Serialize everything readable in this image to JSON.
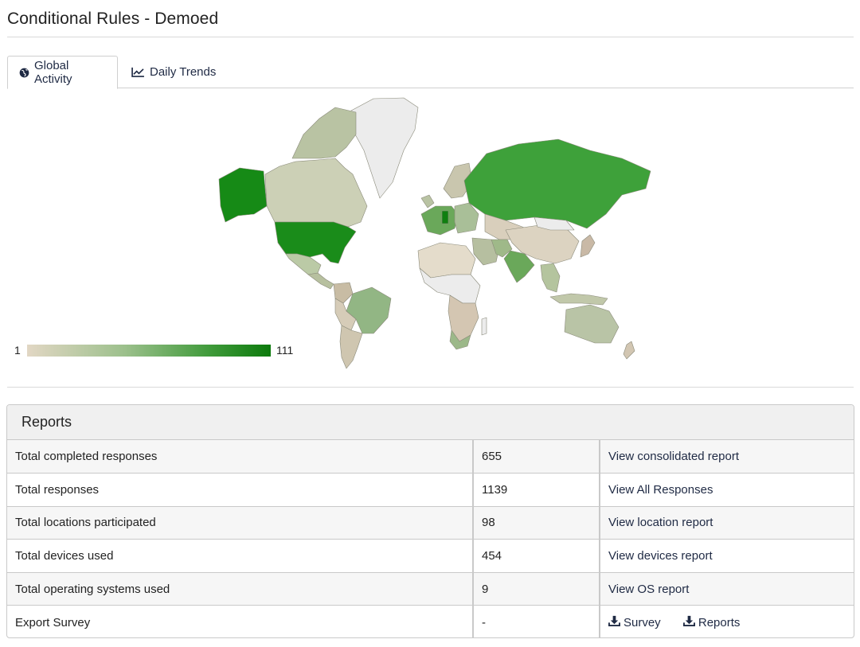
{
  "header": {
    "title": "Conditional Rules - Demoed"
  },
  "tabs": [
    {
      "label": "Global Activity",
      "icon": "globe-icon",
      "active": true
    },
    {
      "label": "Daily Trends",
      "icon": "line-chart-icon",
      "active": false
    }
  ],
  "legend": {
    "min": "1",
    "max": "111"
  },
  "colors": {
    "low": "#e2d7c4",
    "mid": "#9cc08c",
    "high": "#0c7a0c",
    "none": "#ececec"
  },
  "reports": {
    "title": "Reports",
    "rows": [
      {
        "label": "Total completed responses",
        "value": "655",
        "action": "View consolidated report"
      },
      {
        "label": "Total responses",
        "value": "1139",
        "action": "View All Responses"
      },
      {
        "label": "Total locations participated",
        "value": "98",
        "action": "View location report"
      },
      {
        "label": "Total devices used",
        "value": "454",
        "action": "View devices report"
      },
      {
        "label": "Total operating systems used",
        "value": "9",
        "action": "View OS report"
      }
    ],
    "export": {
      "label": "Export Survey",
      "value": "-",
      "survey": "Survey",
      "reports": "Reports"
    }
  }
}
